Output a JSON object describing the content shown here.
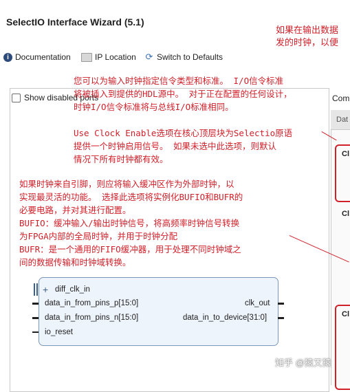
{
  "window": {
    "title": "SelectIO Interface Wizard (5.1)"
  },
  "toolbar": {
    "documentation": "Documentation",
    "ip_location": "IP Location",
    "switch_defaults": "Switch to Defaults"
  },
  "left": {
    "show_disabled_ports": "Show disabled ports"
  },
  "right": {
    "label": "Com",
    "tab": "Dat",
    "sections": [
      "Cl",
      "Cl",
      "Cl"
    ]
  },
  "block": {
    "in_ports": [
      "diff_clk_in",
      "data_in_from_pins_p[15:0]",
      "data_in_from_pins_n[15:0]",
      "io_reset"
    ],
    "out_ports": [
      "clk_out",
      "data_in_to_device[31:0]"
    ]
  },
  "annotations": {
    "top_right": [
      "如果在输出数据",
      "发的时钟，以便"
    ],
    "clock_standard": [
      "您可以为输入时钟指定信令类型和标准。 I/O信令标准",
      "将被插入到提供的HDL源中。 对于正在配置的任何设计，",
      "时钟I/O信令标准将与总线I/O标准相同。"
    ],
    "clock_enable": [
      "Use Clock Enable选项在核心顶层块为Selectio原语",
      "提供一个时钟启用信号。 如果未选中此选项，则默认",
      "情况下所有时钟都有效。"
    ],
    "bufio": [
      "如果时钟来自引脚，则应将输入缓冲区作为外部时钟，以",
      "实现最灵活的功能。 选择此选项将实例化BUFIO和BUFR的",
      "必要电路，并对其进行配置。",
      "BUFIO：缓冲输入/输出时钟信号，将高频率时钟信号转换",
      "为FPGA内部的全局时钟，并用于时钟分配",
      "BUFR：是一个通用的FIFO缓冲器，用于处理不同时钟域之",
      "间的数据传输和时钟域转换。"
    ]
  },
  "watermark": "知乎 @猿又猿"
}
